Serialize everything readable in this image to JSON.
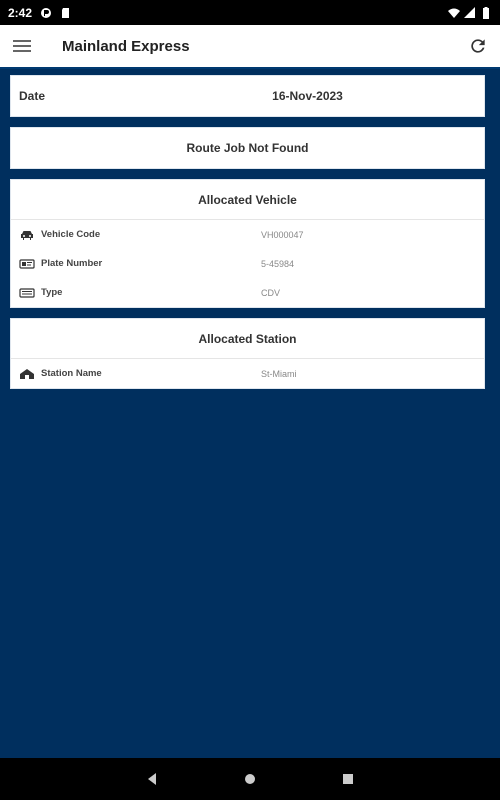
{
  "status_bar": {
    "time": "2:42",
    "icons": [
      "pocket-icon",
      "sd-card-icon"
    ],
    "right_icons": [
      "wifi-icon",
      "signal-icon",
      "battery-icon"
    ]
  },
  "app_bar": {
    "title": "Mainland Express",
    "menu_icon": "hamburger-menu-icon",
    "refresh_icon": "refresh-icon"
  },
  "date_card": {
    "label": "Date",
    "value": "16-Nov-2023"
  },
  "route_job": {
    "message": "Route Job Not Found"
  },
  "allocated_vehicle": {
    "header": "Allocated Vehicle",
    "rows": [
      {
        "icon": "car-icon",
        "label": "Vehicle Code",
        "value": "VH000047"
      },
      {
        "icon": "id-card-icon",
        "label": "Plate Number",
        "value": "5-45984"
      },
      {
        "icon": "type-icon",
        "label": "Type",
        "value": "CDV"
      }
    ]
  },
  "allocated_station": {
    "header": "Allocated Station",
    "rows": [
      {
        "icon": "home-icon",
        "label": "Station Name",
        "value": "St-Miami"
      }
    ]
  },
  "nav": {
    "back_icon": "back-icon",
    "home_icon": "home-button-icon",
    "recents_icon": "recents-icon"
  },
  "colors": {
    "background": "#002f5e",
    "app_bar": "#ffffff",
    "status_bar": "#000000"
  }
}
